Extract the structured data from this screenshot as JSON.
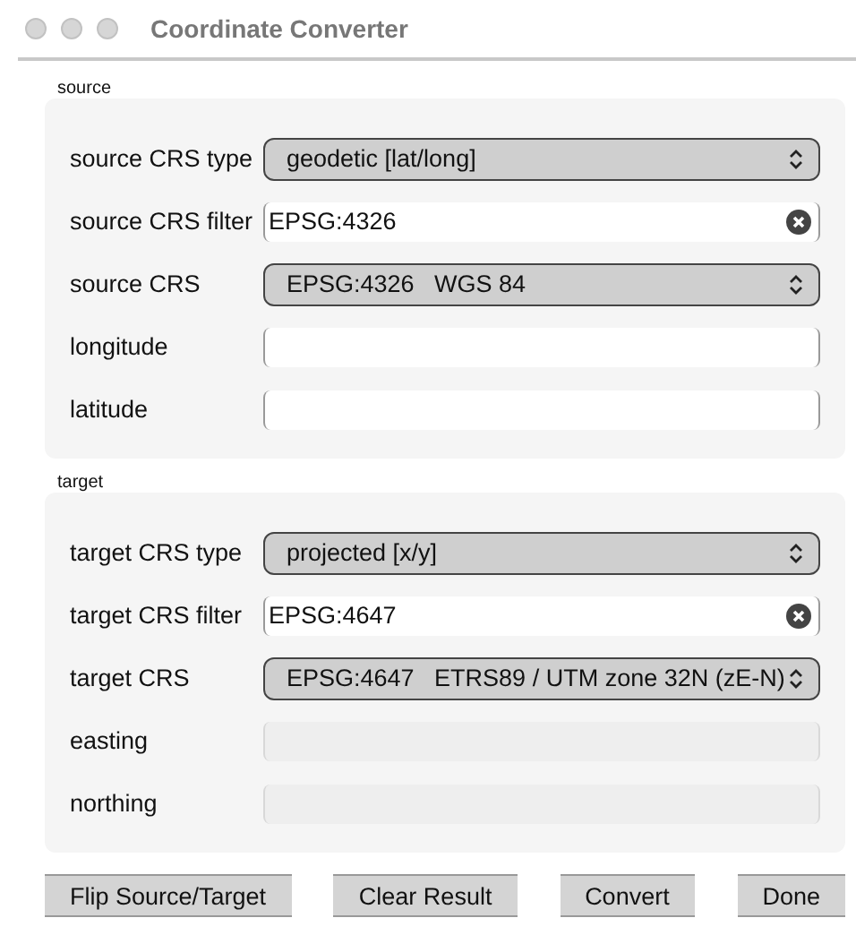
{
  "window": {
    "title": "Coordinate Converter"
  },
  "groups": [
    {
      "title": "source",
      "rows": [
        {
          "kind": "select",
          "label": "source CRS type",
          "value": "geodetic [lat/long]"
        },
        {
          "kind": "filter",
          "label": "source CRS filter",
          "value": "EPSG:4326"
        },
        {
          "kind": "select",
          "label": "source CRS",
          "value": "EPSG:4326   WGS 84"
        },
        {
          "kind": "text",
          "label": "longitude",
          "disabled": false
        },
        {
          "kind": "text",
          "label": "latitude",
          "disabled": false
        }
      ]
    },
    {
      "title": "target",
      "rows": [
        {
          "kind": "select",
          "label": "target CRS type",
          "value": "projected [x/y]"
        },
        {
          "kind": "filter",
          "label": "target CRS filter",
          "value": "EPSG:4647"
        },
        {
          "kind": "select",
          "label": "target CRS",
          "value": "EPSG:4647   ETRS89 / UTM zone 32N (zE-N)"
        },
        {
          "kind": "text",
          "label": "easting",
          "disabled": true
        },
        {
          "kind": "text",
          "label": "northing",
          "disabled": true
        }
      ]
    }
  ],
  "buttons": [
    {
      "label": "Flip Source/Target"
    },
    {
      "label": "Clear Result"
    },
    {
      "label": "Convert"
    },
    {
      "label": "Done"
    }
  ]
}
